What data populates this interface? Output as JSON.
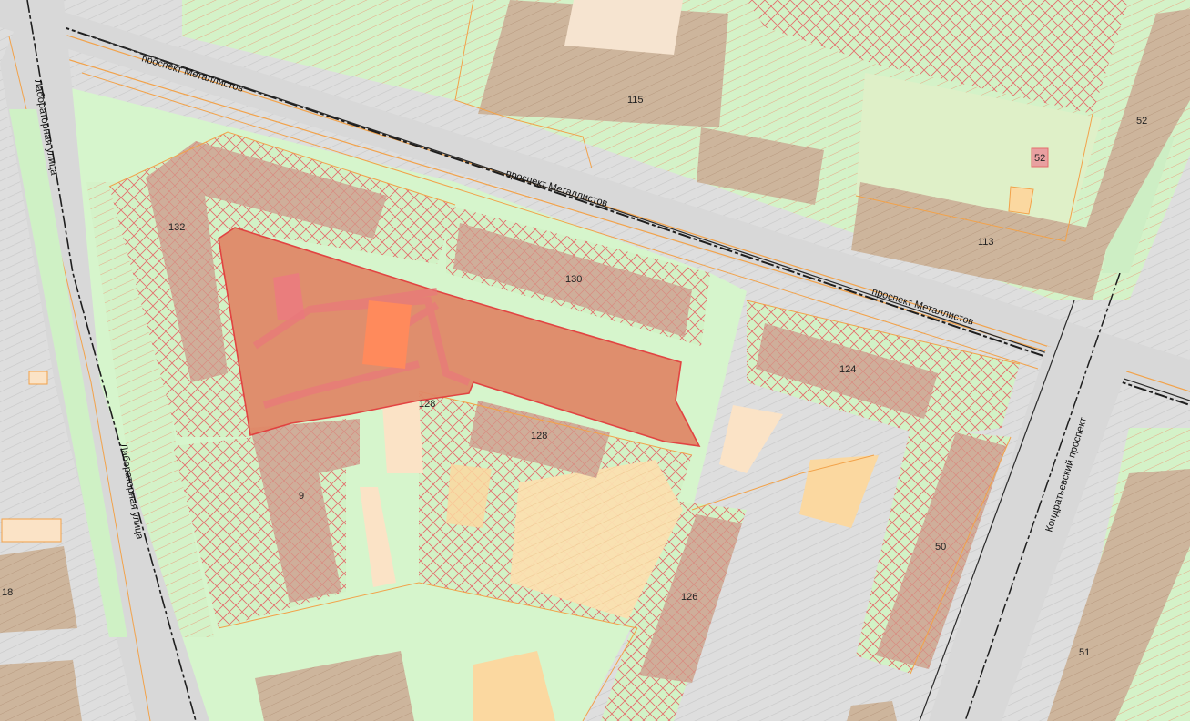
{
  "streets": {
    "metallistov_1": "проспект Металлистов",
    "metallistov_2": "проспект Металлистов",
    "metallistov_3": "проспект Металлистов",
    "laboratornaya_1": "Лабораторная улица",
    "laboratornaya_2": "Лабораторная улица",
    "kondratyevsky": "Кондратьевский проспект"
  },
  "house_numbers": {
    "h115": "115",
    "h52a": "52",
    "h52b": "52",
    "h113": "113",
    "h132": "132",
    "h130": "130",
    "h124": "124",
    "h128a": "128",
    "h128b": "128",
    "h9": "9",
    "h126": "126",
    "h50": "50",
    "h51": "51",
    "h18": "18"
  },
  "colors": {
    "road": "#dcdcdc",
    "green": "#ccf2c4",
    "building": "#cfb49a",
    "selected_parcel": "#e0876a",
    "parcel_border": "#f2a24a",
    "hatch_red": "#e86a6a",
    "rail": "#222222",
    "yellow_zone": "#fbd8a0"
  }
}
